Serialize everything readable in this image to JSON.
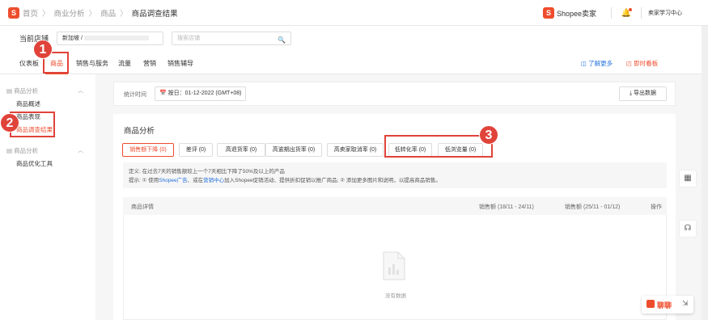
{
  "topbar": {
    "breadcrumb": [
      "首页",
      "商业分析",
      "商品",
      "商品调查结果"
    ],
    "separator": "〉",
    "logo_glyph": "S",
    "brand": "Shopee卖家",
    "learning_center": "卖家学习中心",
    "bell_glyph": "🔔"
  },
  "shop": {
    "label": "当前店铺",
    "selected_prefix": "新加坡 /",
    "search_placeholder": "搜索店铺",
    "search_glyph": "🔍"
  },
  "nav": {
    "tabs": [
      "仪表板",
      "商品",
      "销售与服务",
      "流量",
      "营销",
      "销售辅导"
    ],
    "active_index": 1,
    "learn_more": "了解更多",
    "live_board": "即时看板"
  },
  "sidebar": {
    "group1": "商品分析",
    "items": [
      "商品概述",
      "商品表现",
      "商品调查结果"
    ],
    "active_index": 2,
    "group2": "商品分析",
    "items2": [
      "商品优化工具"
    ],
    "chevron": "︿"
  },
  "stats": {
    "label": "统计时间",
    "date_button": "按日：01-12-2022 (GMT+08)",
    "date_glyph": "📅",
    "export_button": "导出数据",
    "export_glyph": "⤓"
  },
  "analysis": {
    "title": "商品分析",
    "filters": [
      "销售额下降 (0)",
      "差评 (0)",
      "高退货率 (0)",
      "高逾期出货率 (0)",
      "高卖家取消率 (0)",
      "低转化率 (0)",
      "低浏览量 (0)"
    ],
    "active_filter_index": 0,
    "hint_line1": "定义: 在过去7天的销售额较上一个7天相比下降了50%及以上的产品",
    "hint_line2_a": "提示: ① 使用",
    "hint_line2_b": "Shopee广告",
    "hint_line2_c": "、或在",
    "hint_line2_d": "营销中心",
    "hint_line2_e": "加入Shopee促销活动、提供折扣促销以推广商品; ② 添加更多图片和说明，以提高商品销售。",
    "table_headers": [
      "商品详情",
      "销售额 (18/11 - 24/11)",
      "销售额 (25/11 - 01/12)",
      "操作"
    ],
    "empty_text": "没有数据"
  },
  "float": {
    "chat_label": "聊聊",
    "chat_ext_glyph": "⇲",
    "dashboard_glyph": "▦",
    "support_glyph": "☊"
  },
  "badges": [
    "1",
    "2",
    "3"
  ],
  "colors": {
    "accent": "#ee4d2d",
    "badge": "#e0433a",
    "link": "#2673dd"
  }
}
